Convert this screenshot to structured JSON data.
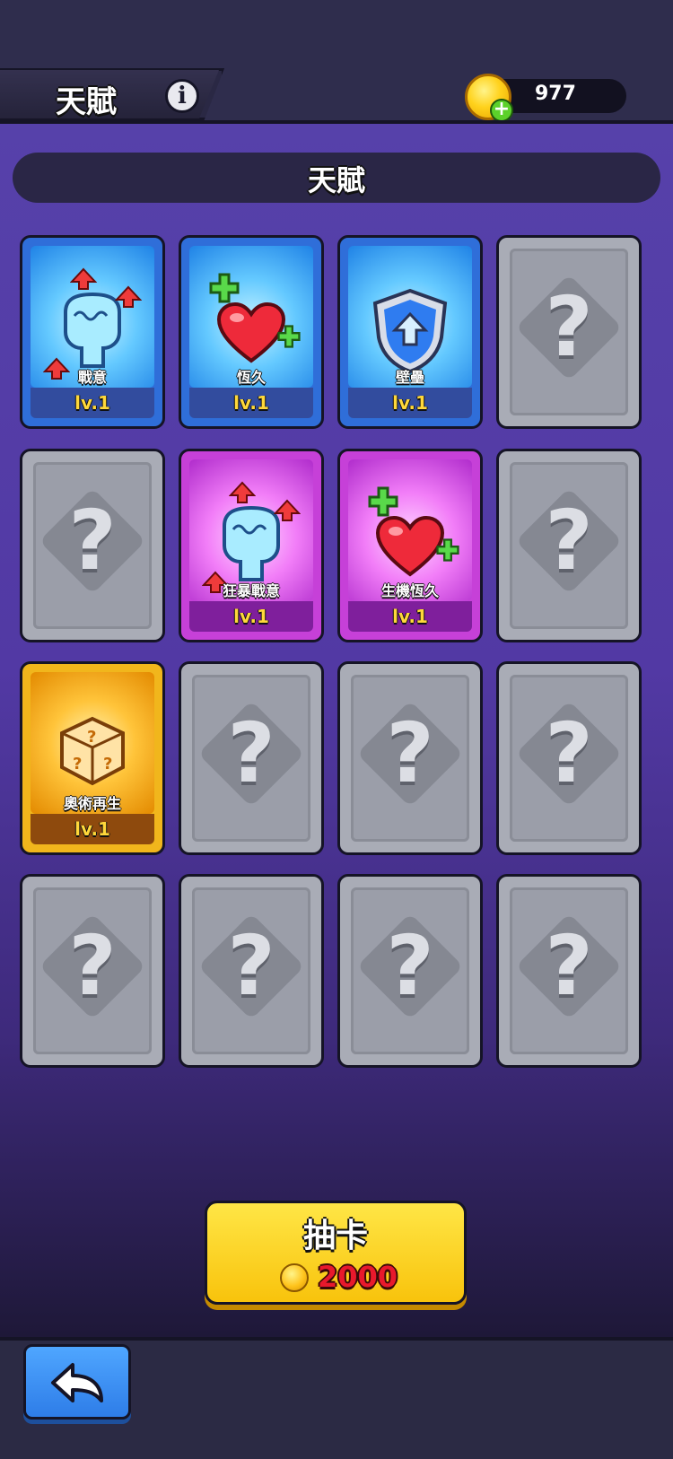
{
  "header": {
    "title": "天賦",
    "info_icon": "info-icon",
    "currency": {
      "icon": "coin-plus-icon",
      "amount": "977"
    }
  },
  "section_title": "天賦",
  "cards": [
    {
      "name": "戰意",
      "level": "lv.1",
      "state": "unlocked",
      "rarity": "blue",
      "art": "fist-icon"
    },
    {
      "name": "恆久",
      "level": "lv.1",
      "state": "unlocked",
      "rarity": "blue",
      "art": "heart-icon"
    },
    {
      "name": "壁壘",
      "level": "lv.1",
      "state": "unlocked",
      "rarity": "blue",
      "art": "shield-icon"
    },
    {
      "state": "locked",
      "glyph": "?"
    },
    {
      "state": "locked",
      "glyph": "?"
    },
    {
      "name": "狂暴戰意",
      "level": "lv.1",
      "state": "unlocked",
      "rarity": "purple",
      "art": "fist-icon"
    },
    {
      "name": "生機恆久",
      "level": "lv.1",
      "state": "unlocked",
      "rarity": "purple",
      "art": "heart-icon"
    },
    {
      "state": "locked",
      "glyph": "?"
    },
    {
      "name": "奧術再生",
      "level": "lv.1",
      "state": "unlocked",
      "rarity": "gold",
      "art": "dice-icon"
    },
    {
      "state": "locked",
      "glyph": "?"
    },
    {
      "state": "locked",
      "glyph": "?"
    },
    {
      "state": "locked",
      "glyph": "?"
    },
    {
      "state": "locked",
      "glyph": "?"
    },
    {
      "state": "locked",
      "glyph": "?"
    },
    {
      "state": "locked",
      "glyph": "?"
    },
    {
      "state": "locked",
      "glyph": "?"
    }
  ],
  "draw_button": {
    "label": "抽卡",
    "cost": "2000",
    "cost_icon": "coin-icon"
  },
  "back_button": {
    "icon": "back-arrow-icon"
  },
  "colors": {
    "background_top": "#5641aa",
    "blue_card": "#2f6ed9",
    "purple_card": "#c640d8",
    "gold_card": "#f1b61c",
    "locked_card": "#a9acb6",
    "level_text": "#ffd83a",
    "draw_button": "#f8c30c",
    "cost_text": "#e8192c",
    "back_button": "#2e7de8"
  }
}
